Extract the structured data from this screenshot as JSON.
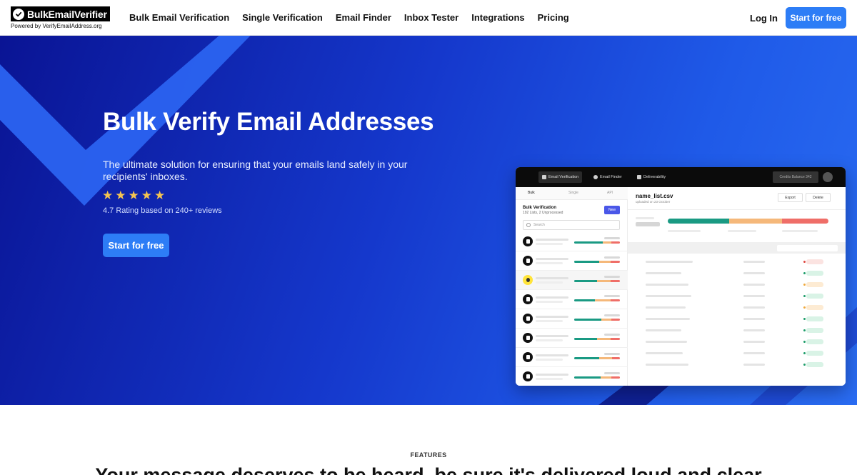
{
  "brand": {
    "name": "BulkEmailVerifier",
    "tagline": "Powered by VerifyEmailAddress.org"
  },
  "nav": {
    "links": [
      "Bulk Email Verification",
      "Single Verification",
      "Email Finder",
      "Inbox Tester",
      "Integrations",
      "Pricing"
    ],
    "login": "Log In",
    "cta": "Start for free"
  },
  "hero": {
    "title": "Bulk Verify Email Addresses",
    "subtitle": "The ultimate solution for ensuring that your emails land safely in your recipients' inboxes.",
    "rating_stars": 5,
    "rating_text": "4.7 Rating based on 240+ reviews",
    "cta": "Start for free"
  },
  "app_mockup": {
    "tabs": [
      "Email Verification",
      "Email Finder",
      "Deliverability"
    ],
    "credits": "Credits Balance 342",
    "subtabs": [
      "Bulk",
      "Single",
      "API"
    ],
    "sidebar_title": "Bulk Verification",
    "sidebar_subtitle": "192 Lists, 2 Unprocessed",
    "new_button": "New",
    "search_placeholder": "Search",
    "file_name": "name_list.csv",
    "file_uploaded": "uploaded on 23 October",
    "export_button": "Export",
    "delete_button": "Delete"
  },
  "colors": {
    "brand_blue": "#2d7df6",
    "valid": "#1a9a83",
    "risky": "#f5b87a",
    "invalid": "#ef6e68",
    "star": "#f5c451"
  },
  "features": {
    "label": "FEATURES",
    "heading": "Your message deserves to be heard, be sure it's delivered loud and clear"
  }
}
